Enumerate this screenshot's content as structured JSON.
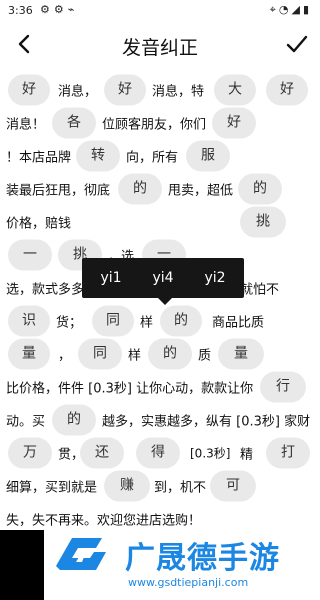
{
  "status_bar": {
    "time": "3:36",
    "left_icons": [
      "gear-icon",
      "gear-icon",
      "cast-icon"
    ],
    "right_icons": [
      "location-icon",
      "wifi-icon",
      "signal-icon",
      "battery-icon"
    ]
  },
  "app_bar": {
    "title": "发音纠正",
    "back_icon": "arrow-left-icon",
    "confirm_icon": "check-icon"
  },
  "text_rows": [
    [
      {
        "kind": "pill",
        "text": "好"
      },
      {
        "kind": "text",
        "text": "消息，"
      },
      {
        "kind": "pill",
        "text": "好"
      },
      {
        "kind": "text",
        "text": "消息，特"
      },
      {
        "kind": "pill",
        "text": "大"
      },
      {
        "kind": "pill",
        "text": "好"
      }
    ],
    [
      {
        "kind": "text",
        "text": "消息！"
      },
      {
        "kind": "pill",
        "text": "各"
      },
      {
        "kind": "text",
        "text": "位顾客朋友，你们"
      },
      {
        "kind": "pill",
        "text": "好"
      }
    ],
    [
      {
        "kind": "text",
        "text": "！本店品牌"
      },
      {
        "kind": "pill",
        "text": "转"
      },
      {
        "kind": "text",
        "text": "向，所有"
      },
      {
        "kind": "pill",
        "text": "服"
      }
    ],
    [
      {
        "kind": "text",
        "text": "装最后狂甩，彻底"
      },
      {
        "kind": "pill",
        "text": "的"
      },
      {
        "kind": "text",
        "text": "甩卖，超低"
      },
      {
        "kind": "pill",
        "text": "的"
      }
    ],
    [
      {
        "kind": "text",
        "text": "价格，赔钱"
      },
      {
        "kind": "pill",
        "text": "挑"
      }
    ],
    [
      {
        "kind": "pill",
        "text": "一"
      },
      {
        "kind": "pill",
        "text": "挑"
      },
      {
        "kind": "text",
        "text": "，选"
      },
      {
        "kind": "pill",
        "text": "一"
      }
    ],
    [
      {
        "kind": "text",
        "text": "选，款式多多，实惠多多。不怕货比货，就怕不"
      }
    ],
    [
      {
        "kind": "pill",
        "text": "识"
      },
      {
        "kind": "text",
        "text": "货；"
      },
      {
        "kind": "pill",
        "text": "同"
      },
      {
        "kind": "text",
        "text": "样"
      },
      {
        "kind": "pill",
        "text": "的"
      },
      {
        "kind": "text",
        "text": "商品比质"
      }
    ],
    [
      {
        "kind": "pill",
        "text": "量"
      },
      {
        "kind": "text",
        "text": "，"
      },
      {
        "kind": "pill",
        "text": "同"
      },
      {
        "kind": "text",
        "text": "样"
      },
      {
        "kind": "pill",
        "text": "的"
      },
      {
        "kind": "text",
        "text": "质"
      },
      {
        "kind": "pill",
        "text": "量"
      }
    ],
    [
      {
        "kind": "text",
        "text": "比价格，件件 [0.3秒] 让你心动，款款让你"
      },
      {
        "kind": "pill",
        "text": "行"
      }
    ],
    [
      {
        "kind": "text",
        "text": "动。买"
      },
      {
        "kind": "pill",
        "text": "的"
      },
      {
        "kind": "text",
        "text": "越多，实惠越多，纵有 [0.3秒] 家财"
      }
    ],
    [
      {
        "kind": "pill",
        "text": "万"
      },
      {
        "kind": "text",
        "text": "贯，"
      },
      {
        "kind": "pill",
        "text": "还"
      },
      {
        "kind": "pill",
        "text": "得"
      },
      {
        "kind": "box",
        "text": "[0.3秒]"
      },
      {
        "kind": "text",
        "text": "精"
      },
      {
        "kind": "pill",
        "text": "打"
      }
    ],
    [
      {
        "kind": "text",
        "text": "细算，买到就是"
      },
      {
        "kind": "pill",
        "text": "赚"
      },
      {
        "kind": "text",
        "text": "到，机不"
      },
      {
        "kind": "pill",
        "text": "可"
      }
    ],
    [
      {
        "kind": "text",
        "text": "失，失不再来。欢迎您进店选购！"
      }
    ]
  ],
  "pinyin_popup": {
    "options": [
      "yi1",
      "yi4",
      "yi2"
    ]
  },
  "watermark": {
    "title": "广晟德手游",
    "url": "www.gsdtiepianji.com",
    "logo_icon": "g-logo-icon",
    "color": "#1c87e3"
  }
}
